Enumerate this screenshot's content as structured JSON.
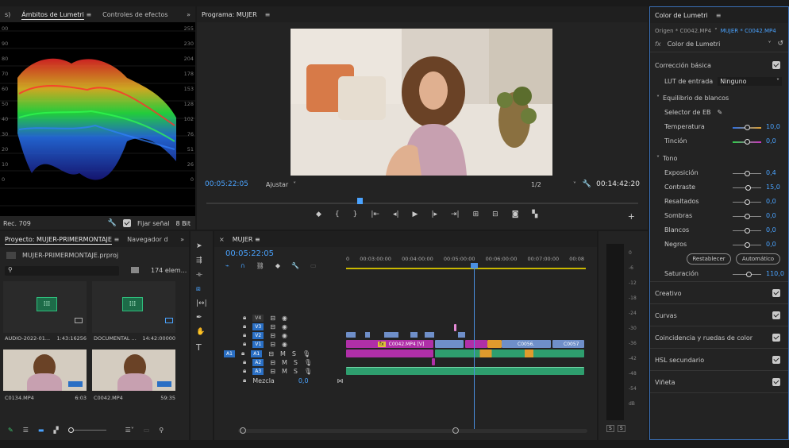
{
  "lumetri_scopes": {
    "tab_left_fragment": "s)",
    "tab_active": "Ámbitos de Lumetri",
    "tab_menu": "≡",
    "tab_next": "Controles de efectos",
    "overflow": "»",
    "y_left": [
      "00",
      "90",
      "80",
      "70",
      "60",
      "50",
      "40",
      "30",
      "20",
      "10",
      "0"
    ],
    "y_right": [
      "255",
      "230",
      "204",
      "178",
      "153",
      "128",
      "102",
      "76",
      "51",
      "26",
      "0"
    ],
    "footer_left": "Rec. 709",
    "fijar": "Fijar señal",
    "bit": "8 Bit"
  },
  "program": {
    "title": "Programa: MUJER",
    "menu": "≡",
    "timecode": "00:05:22:05",
    "fit": "Ajustar",
    "resolution": "1/2",
    "duration": "00:14:42:20"
  },
  "project": {
    "title": "Proyecto: MUJER-PRIMERMONTAJE",
    "menu": "≡",
    "next_tab": "Navegador d",
    "overflow": "»",
    "file": "MUJER-PRIMERMONTAJE.prproj",
    "count": "174 elem...",
    "items": [
      {
        "name": "AUDIO-2022-01...",
        "duration": "1:43:16256",
        "kind": "audio"
      },
      {
        "name": "DOCUMENTAL ...",
        "duration": "14:42:00000",
        "kind": "audio"
      },
      {
        "name": "C0134.MP4",
        "duration": "6:03",
        "kind": "video"
      },
      {
        "name": "C0042.MP4",
        "duration": "59:35",
        "kind": "video"
      }
    ]
  },
  "timeline": {
    "title": "MUJER",
    "menu": "≡",
    "close": "×",
    "timecode": "00:05:22:05",
    "ruler": [
      "0",
      "00:03:00:00",
      "00:04:00:00",
      "00:05:00:00",
      "00:06:00:00",
      "00:07:00:00",
      "00:08"
    ],
    "tracks_video": [
      "V4",
      "V3",
      "V2",
      "V1"
    ],
    "tracks_audio": [
      "A1",
      "A2",
      "A3"
    ],
    "source_audio": "A1",
    "mix_label": "Mezcla",
    "mix_value": "0,0",
    "clip_labels": [
      "C0042.MP4 [V]",
      "C0056.",
      "C0057"
    ],
    "fx_badge": "fx"
  },
  "meter": {
    "scale": [
      "0",
      "-6",
      "-12",
      "-18",
      "-24",
      "-30",
      "-36",
      "-42",
      "-48",
      "-54",
      "dB"
    ],
    "solo": [
      "S",
      "S"
    ]
  },
  "lumetri_color": {
    "title": "Color de Lumetri",
    "menu": "≡",
    "source": "Origen * C0042.MP4",
    "sequence": "MUJER * C0042.MP4",
    "fx_prefix": "fx",
    "effect": "Color de Lumetri",
    "basic": "Corrección básica",
    "lut_label": "LUT de entrada",
    "lut_value": "Ninguno",
    "wb_section": "Equilibrio de blancos",
    "wb_selector": "Selector de EB",
    "temperature_label": "Temperatura",
    "temperature_value": "10,0",
    "tint_label": "Tinción",
    "tint_value": "0,0",
    "tone_section": "Tono",
    "tone": [
      {
        "label": "Exposición",
        "value": "0,4",
        "pos": 0.52
      },
      {
        "label": "Contraste",
        "value": "15,0",
        "pos": 0.55
      },
      {
        "label": "Resaltados",
        "value": "0,0",
        "pos": 0.5
      },
      {
        "label": "Sombras",
        "value": "0,0",
        "pos": 0.5
      },
      {
        "label": "Blancos",
        "value": "0,0",
        "pos": 0.5
      },
      {
        "label": "Negros",
        "value": "0,0",
        "pos": 0.5
      }
    ],
    "reset": "Restablecer",
    "auto": "Automático",
    "saturation_label": "Saturación",
    "saturation_value": "110,0",
    "sections": [
      "Creativo",
      "Curvas",
      "Coincidencia y ruedas de color",
      "HSL secundario",
      "Viñeta"
    ]
  },
  "colors": {
    "accent": "#4aa3ff",
    "playhead": "#4a90e2",
    "clip_magenta": "#b02fa8",
    "clip_blue": "#6f8fc9",
    "clip_green": "#2e9e6e",
    "clip_orange": "#e09b2d"
  }
}
